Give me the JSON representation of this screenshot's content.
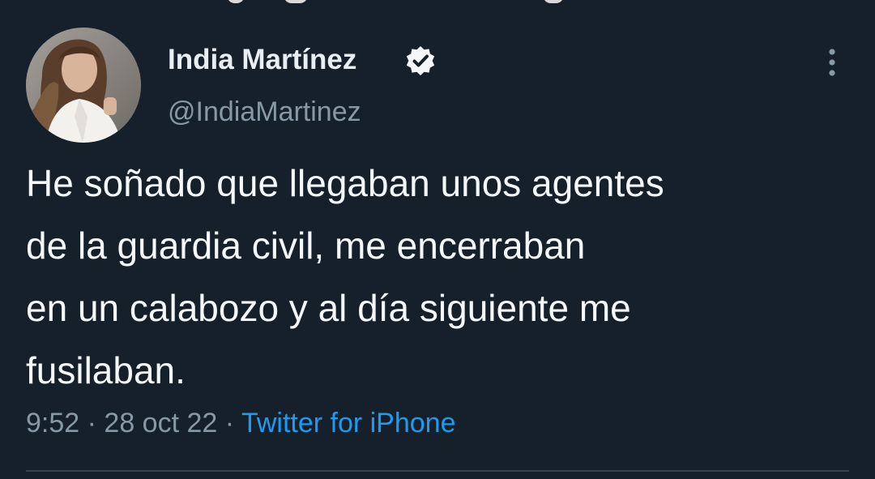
{
  "tweet": {
    "author": {
      "display_name": "India Martínez",
      "handle": "@IndiaMartinez",
      "verified": true
    },
    "text": "He soñado que llegaban unos agentes\nde la guardia civil, me encerraban\nen un calabozo y al día siguiente me\nfusilaban.",
    "time": "9:52",
    "separator": "·",
    "date": "28 oct 22",
    "source": "Twitter for iPhone"
  },
  "icons": {
    "verified": "verified-badge-icon",
    "more": "more-vertical-icon"
  },
  "colors": {
    "background": "#15202b",
    "primary_text": "#f5f8fa",
    "secondary_text": "#8899a6",
    "link": "#1d9bf0",
    "divider": "#38444d"
  }
}
